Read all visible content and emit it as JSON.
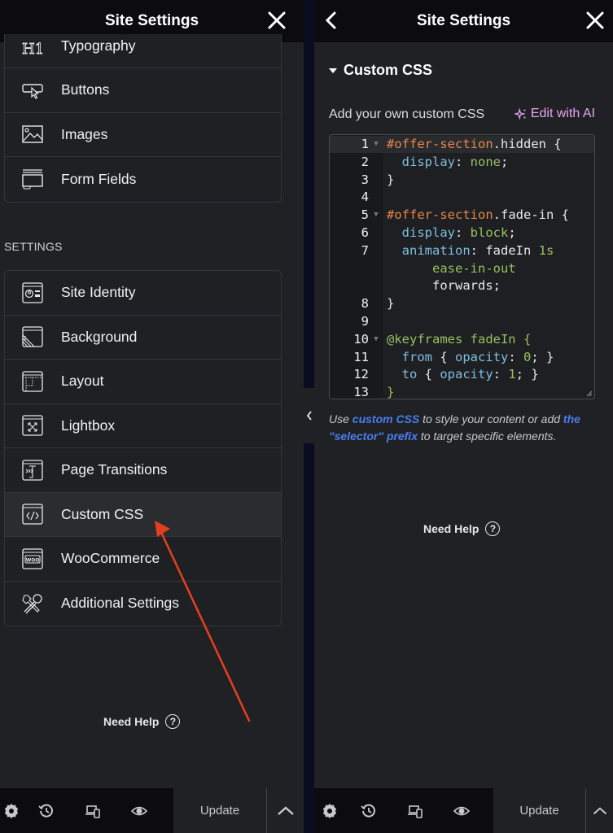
{
  "left_panel": {
    "title": "Site Settings",
    "top_items": [
      {
        "label": "Typography",
        "icon": "h1-icon"
      },
      {
        "label": "Buttons",
        "icon": "button-cursor-icon"
      },
      {
        "label": "Images",
        "icon": "image-icon"
      },
      {
        "label": "Form Fields",
        "icon": "form-fields-icon"
      }
    ],
    "section_label": "SETTINGS",
    "settings_items": [
      {
        "label": "Site Identity",
        "icon": "site-identity-icon"
      },
      {
        "label": "Background",
        "icon": "background-icon"
      },
      {
        "label": "Layout",
        "icon": "layout-icon"
      },
      {
        "label": "Lightbox",
        "icon": "lightbox-icon"
      },
      {
        "label": "Page Transitions",
        "icon": "page-transitions-icon"
      },
      {
        "label": "Custom CSS",
        "icon": "code-icon",
        "active": true
      },
      {
        "label": "WooCommerce",
        "icon": "woocommerce-icon"
      },
      {
        "label": "Additional Settings",
        "icon": "tools-icon"
      }
    ],
    "need_help": "Need Help",
    "footer": {
      "update_label": "Update"
    }
  },
  "right_panel": {
    "title": "Site Settings",
    "section_title": "Custom CSS",
    "editor_label": "Add your own custom CSS",
    "ai_button": "Edit with AI",
    "code_lines": [
      {
        "num": "1",
        "fold": true,
        "tokens": [
          [
            "sel",
            "#offer-section"
          ],
          [
            "plain",
            ".hidden {"
          ]
        ]
      },
      {
        "num": "2",
        "tokens": [
          [
            "plain",
            "  "
          ],
          [
            "prop",
            "display"
          ],
          [
            "plain",
            ": "
          ],
          [
            "val",
            "none"
          ],
          [
            "plain",
            ";"
          ]
        ]
      },
      {
        "num": "3",
        "tokens": [
          [
            "plain",
            "}"
          ]
        ]
      },
      {
        "num": "4",
        "tokens": []
      },
      {
        "num": "5",
        "fold": true,
        "tokens": [
          [
            "sel",
            "#offer-section"
          ],
          [
            "plain",
            ".fade-in {"
          ]
        ]
      },
      {
        "num": "6",
        "tokens": [
          [
            "plain",
            "  "
          ],
          [
            "prop",
            "display"
          ],
          [
            "plain",
            ": "
          ],
          [
            "val",
            "block"
          ],
          [
            "plain",
            ";"
          ]
        ]
      },
      {
        "num": "7",
        "tokens": [
          [
            "plain",
            "  "
          ],
          [
            "prop",
            "animation"
          ],
          [
            "plain",
            ": fadeIn "
          ],
          [
            "val",
            "1s"
          ]
        ]
      },
      {
        "num": "",
        "tokens": [
          [
            "plain",
            "      "
          ],
          [
            "val",
            "ease-in-out"
          ]
        ]
      },
      {
        "num": "",
        "tokens": [
          [
            "plain",
            "      forwards;"
          ]
        ]
      },
      {
        "num": "8",
        "tokens": [
          [
            "plain",
            "}"
          ]
        ]
      },
      {
        "num": "9",
        "tokens": []
      },
      {
        "num": "10",
        "fold": true,
        "tokens": [
          [
            "at",
            "@keyframes fadeIn {"
          ]
        ]
      },
      {
        "num": "11",
        "tokens": [
          [
            "plain",
            "  "
          ],
          [
            "prop",
            "from"
          ],
          [
            "plain",
            " { "
          ],
          [
            "prop",
            "opacity"
          ],
          [
            "plain",
            ": "
          ],
          [
            "val",
            "0"
          ],
          [
            "plain",
            "; }"
          ]
        ]
      },
      {
        "num": "12",
        "tokens": [
          [
            "plain",
            "  "
          ],
          [
            "prop",
            "to"
          ],
          [
            "plain",
            " { "
          ],
          [
            "prop",
            "opacity"
          ],
          [
            "plain",
            ": "
          ],
          [
            "val",
            "1"
          ],
          [
            "plain",
            "; }"
          ]
        ]
      },
      {
        "num": "13",
        "tokens": [
          [
            "at",
            "}"
          ]
        ]
      }
    ],
    "hint": {
      "prefix": "Use ",
      "link1": "custom CSS",
      "middle": " to style your content or add ",
      "link2": "the \"selector\" prefix",
      "suffix": " to target specific elements."
    },
    "need_help": "Need Help",
    "footer": {
      "update_label": "Update"
    }
  },
  "annotation": {
    "type": "red-arrow",
    "points_to": "Custom CSS",
    "color": "#e0401f"
  },
  "colors": {
    "panel_bg": "#202125",
    "header_bg": "#0c0c0e",
    "ai_accent": "#e7a4f0",
    "link": "#4a7df0"
  }
}
